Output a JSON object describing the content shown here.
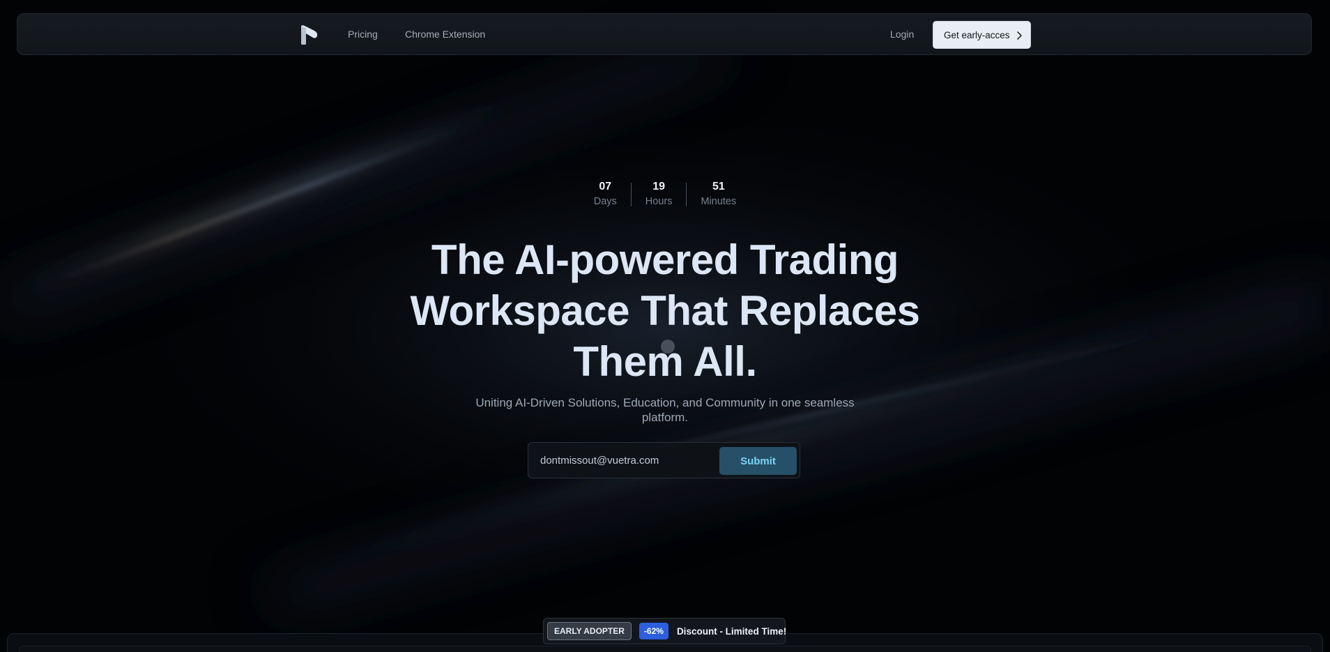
{
  "nav": {
    "logo_icon": "brand-logo-icon",
    "links": [
      {
        "label": "Pricing"
      },
      {
        "label": "Chrome Extension"
      }
    ],
    "login_label": "Login",
    "cta_label": "Get early-acces",
    "cta_icon": "chevron-right-icon"
  },
  "countdown": {
    "days": {
      "value": "07",
      "label": "Days"
    },
    "hours": {
      "value": "19",
      "label": "Hours"
    },
    "minutes": {
      "value": "51",
      "label": "Minutes"
    }
  },
  "hero": {
    "headline_lines": [
      "The AI-powered Trading",
      "Workspace That Replaces",
      "Them All."
    ],
    "subtitle": "Uniting AI-Driven Solutions, Education, and Community in one seamless platform."
  },
  "signup": {
    "email_value": "dontmissout@vuetra.com",
    "submit_label": "Submit"
  },
  "promo": {
    "tag": "EARLY ADOPTER",
    "discount": "-62%",
    "text": "Discount - Limited Time!"
  },
  "colors": {
    "background": "#020305",
    "headline": "#dce6f4",
    "submit_bg": "#265068",
    "submit_text": "#7ed3f4",
    "discount_badge": "#2d5fdc"
  }
}
